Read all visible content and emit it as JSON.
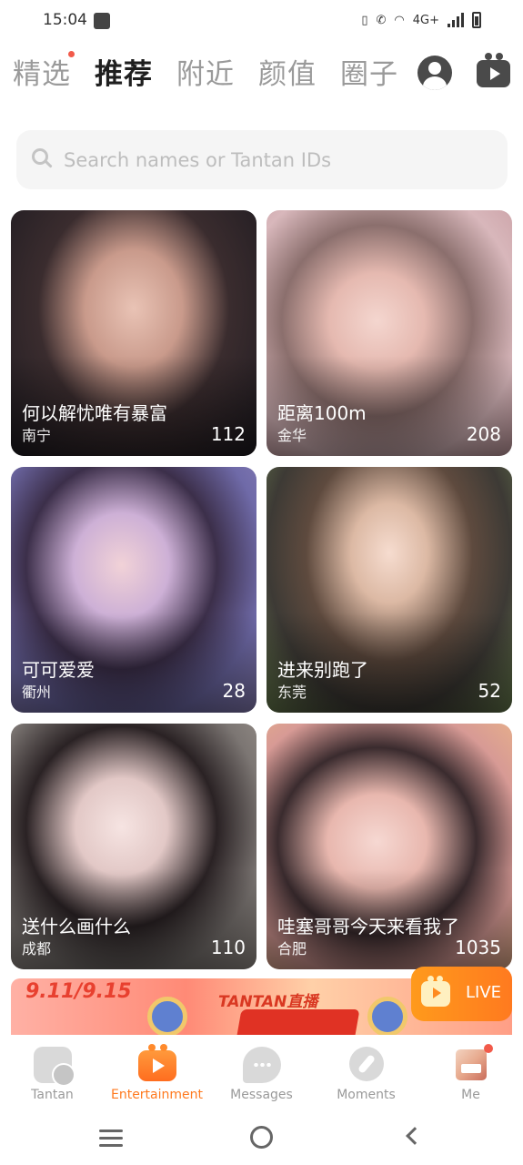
{
  "status_bar": {
    "time": "15:04",
    "network": "4G+",
    "icons": [
      "notification-icon",
      "vibrate-icon",
      "call-wifi-icon",
      "wifi-icon",
      "signal-icon",
      "battery-icon"
    ]
  },
  "top_tabs": [
    {
      "label": "精选",
      "active": false,
      "dot": true
    },
    {
      "label": "推荐",
      "active": true,
      "dot": false
    },
    {
      "label": "附近",
      "active": false,
      "dot": false
    },
    {
      "label": "颜值",
      "active": false,
      "dot": false
    },
    {
      "label": "圈子",
      "active": false,
      "dot": false
    }
  ],
  "top_icons": [
    "profile-icon",
    "live-tv-icon"
  ],
  "search": {
    "placeholder": "Search names or Tantan IDs",
    "value": ""
  },
  "cards": [
    {
      "title": "何以解忧唯有暴富",
      "city": "南宁",
      "count": "112",
      "tone": "#3b2a2a"
    },
    {
      "title": "距离100m",
      "city": "金华",
      "count": "208",
      "tone": "#cfa6a6"
    },
    {
      "title": "可可爱爱",
      "city": "衢州",
      "count": "28",
      "tone": "#6e5fa8"
    },
    {
      "title": "进来别跑了",
      "city": "东莞",
      "count": "52",
      "tone": "#5a4e45"
    },
    {
      "title": "送什么画什么",
      "city": "成都",
      "count": "110",
      "tone": "#8a7d78"
    },
    {
      "title": "哇塞哥哥今天来看我了",
      "city": "合肥",
      "count": "1035",
      "tone": "#c69a9a"
    }
  ],
  "banner": {
    "date": "9.11/9.15",
    "text": "TANTAN直播"
  },
  "live_chip": {
    "label": "LIVE"
  },
  "bottom_nav": [
    {
      "label": "Tantan",
      "icon": "tantan-icon",
      "active": false
    },
    {
      "label": "Entertainment",
      "icon": "entertainment-icon",
      "active": true
    },
    {
      "label": "Messages",
      "icon": "messages-icon",
      "active": false
    },
    {
      "label": "Moments",
      "icon": "moments-icon",
      "active": false
    },
    {
      "label": "Me",
      "icon": "me-avatar-icon",
      "active": false,
      "dot": true
    }
  ],
  "colors": {
    "accent": "#ff7a1f",
    "notification_dot": "#f25a4a",
    "inactive": "#9a9a9a"
  }
}
